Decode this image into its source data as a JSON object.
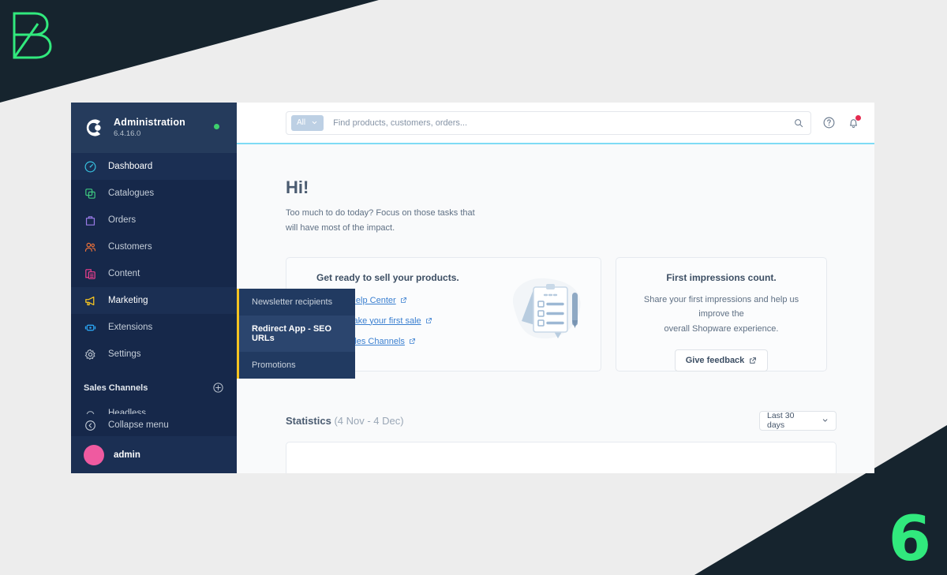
{
  "decor": {
    "top_left_logo": "letter-b-logo",
    "bottom_right_mark": "6",
    "accent_color": "#31e97d",
    "dark_color": "#16242e"
  },
  "sidebar": {
    "brand": {
      "logo_icon": "shopware-logo",
      "title": "Administration",
      "version": "6.4.16.0",
      "status_dot_color": "#3ecf6d"
    },
    "items": [
      {
        "label": "Dashboard",
        "icon": "dashboard-icon",
        "color": "#37c2e0",
        "active": true
      },
      {
        "label": "Catalogues",
        "icon": "catalogues-icon",
        "color": "#3ec77f",
        "active": false
      },
      {
        "label": "Orders",
        "icon": "orders-icon",
        "color": "#9a7be8",
        "active": false
      },
      {
        "label": "Customers",
        "icon": "customers-icon",
        "color": "#e8703a",
        "active": false
      },
      {
        "label": "Content",
        "icon": "content-icon",
        "color": "#ef3f8e",
        "active": false
      },
      {
        "label": "Marketing",
        "icon": "marketing-icon",
        "color": "#f5c421",
        "active": true
      },
      {
        "label": "Extensions",
        "icon": "extensions-icon",
        "color": "#2aa3f0",
        "active": false
      },
      {
        "label": "Settings",
        "icon": "settings-icon",
        "color": "#b9c2cd",
        "active": false
      }
    ],
    "sales_channels": {
      "label": "Sales Channels",
      "add_icon": "plus-circle-icon",
      "channels": [
        {
          "label": "Headless",
          "icon": "headless-icon"
        }
      ]
    },
    "collapse": {
      "label": "Collapse menu",
      "icon": "collapse-icon"
    },
    "user": {
      "name": "admin",
      "avatar_color": "#ef5aa0"
    }
  },
  "flyout": {
    "border_color": "#f5c421",
    "items": [
      {
        "label": "Newsletter recipients",
        "highlighted": false
      },
      {
        "label": "Redirect App - SEO URLs",
        "highlighted": true
      },
      {
        "label": "Promotions",
        "highlighted": false
      }
    ]
  },
  "header": {
    "search": {
      "scope_label": "All",
      "scope_chevron_icon": "chevron-down-icon",
      "placeholder": "Find products, customers, orders...",
      "value": "",
      "search_icon": "search-icon"
    },
    "help_icon": "help-circle-icon",
    "notifications_icon": "bell-icon",
    "notification_dot_color": "#e52b50",
    "accent_border_color": "#7fdbf5"
  },
  "main": {
    "greeting_title": "Hi!",
    "greeting_sub_line1": "Too much to do today? Focus on those tasks that",
    "greeting_sub_line2": "will have most of the impact.",
    "card_products": {
      "title": "Get ready to sell your products.",
      "links": [
        {
          "text": "Visit the Help Center",
          "external_icon": "external-link-icon"
        },
        {
          "text": "How to make your first sale",
          "external_icon": "external-link-icon"
        },
        {
          "text": "Set up Sales Channels",
          "external_icon": "external-link-icon"
        }
      ],
      "illustration": "clipboard-checklist-pen-illustration"
    },
    "card_feedback": {
      "title": "First impressions count.",
      "body_line1": "Share your first impressions and help us improve the",
      "body_line2": "overall Shopware experience.",
      "button_label": "Give feedback",
      "button_icon": "external-link-icon"
    },
    "statistics": {
      "title": "Statistics",
      "range_label": "(4 Nov - 4 Dec)",
      "select_value": "Last 30 days",
      "select_chevron_icon": "chevron-down-icon"
    }
  }
}
